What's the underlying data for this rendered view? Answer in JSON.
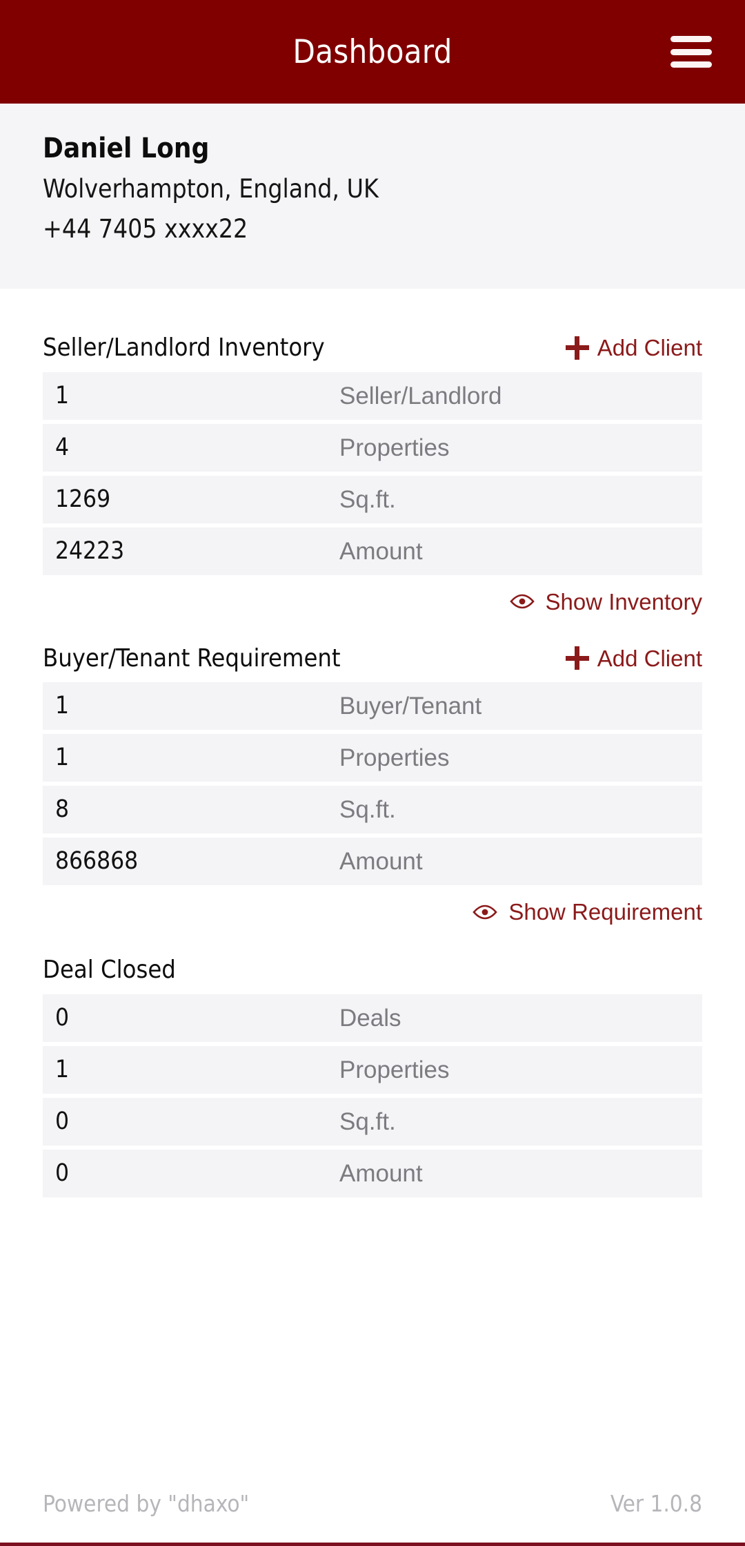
{
  "appbar": {
    "title": "Dashboard",
    "menu_icon": "hamburger-menu-icon"
  },
  "profile": {
    "name": "Daniel Long",
    "location": "Wolverhampton, England, UK",
    "phone": "+44 7405 xxxx22"
  },
  "colors": {
    "brand": "#800000",
    "accent_link": "#8b1a1a",
    "row_bg": "#f4f3f5",
    "profile_bg": "#f5f4f6",
    "muted_text": "#7b7b80",
    "footer_text": "#b6b6ba",
    "footer_rule": "#7a1020"
  },
  "sections": [
    {
      "title": "Seller/Landlord Inventory",
      "add_client_label": "Add Client",
      "add_icon": "plus-icon",
      "rows": [
        {
          "value": "1",
          "label": "Seller/Landlord"
        },
        {
          "value": "4",
          "label": "Properties"
        },
        {
          "value": "1269",
          "label": "Sq.ft."
        },
        {
          "value": "24223",
          "label": "Amount"
        }
      ],
      "show_link_label": "Show Inventory",
      "show_icon": "eye-icon"
    },
    {
      "title": "Buyer/Tenant Requirement",
      "add_client_label": "Add Client",
      "add_icon": "plus-icon",
      "rows": [
        {
          "value": "1",
          "label": "Buyer/Tenant"
        },
        {
          "value": "1",
          "label": "Properties"
        },
        {
          "value": "8",
          "label": "Sq.ft."
        },
        {
          "value": "866868",
          "label": "Amount"
        }
      ],
      "show_link_label": "Show Requirement",
      "show_icon": "eye-icon"
    },
    {
      "title": "Deal Closed",
      "rows": [
        {
          "value": "0",
          "label": "Deals"
        },
        {
          "value": "1",
          "label": "Properties"
        },
        {
          "value": "0",
          "label": "Sq.ft."
        },
        {
          "value": "0",
          "label": "Amount"
        }
      ]
    }
  ],
  "footer": {
    "powered_by": "Powered by \"dhaxo\"",
    "version": "Ver 1.0.8"
  }
}
